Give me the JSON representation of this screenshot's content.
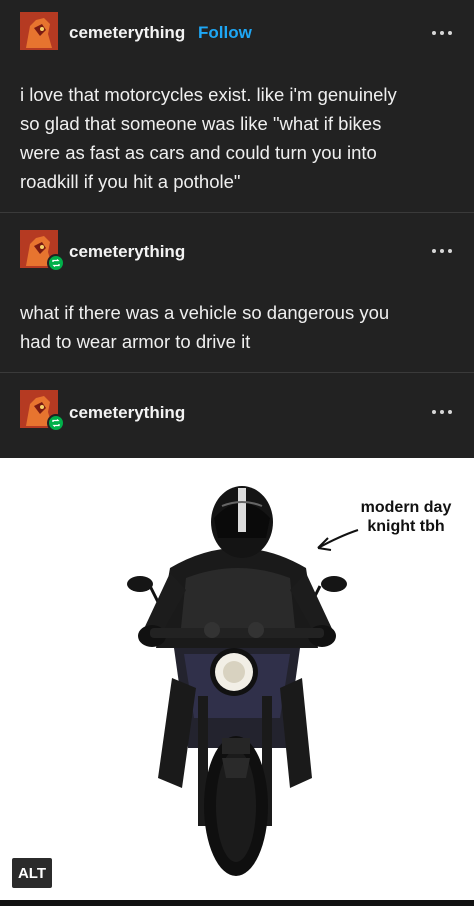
{
  "post1": {
    "username": "cemeterything",
    "follow_label": "Follow",
    "text_lines": [
      "i love that motorcycles exist. like i'm genuinely",
      "so glad that someone was like \"what if bikes",
      "were as fast as cars and could turn you into",
      "roadkill if you hit a pothole\""
    ]
  },
  "post2": {
    "username": "cemeterything",
    "text_lines": [
      "what if there was a vehicle so dangerous you",
      "had to wear armor to drive it"
    ]
  },
  "post3": {
    "username": "cemeterything",
    "image": {
      "caption_lines": [
        "modern day",
        "knight tbh"
      ],
      "alt_label": "ALT"
    }
  },
  "icons": {
    "more": "ellipsis-icon",
    "reblog": "reblog-icon",
    "avatar": "avatar-image"
  },
  "colors": {
    "background": "#222222",
    "follow": "#1ea7f5",
    "reblog_badge": "#00b04a",
    "text": "#efefef"
  }
}
